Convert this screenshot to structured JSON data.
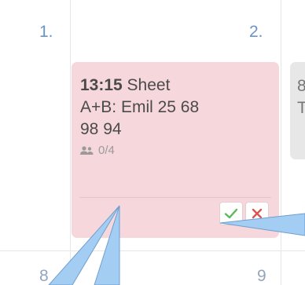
{
  "calendar": {
    "day_numbers": {
      "d1": "1.",
      "d2": "2.",
      "d8": "8",
      "d9": "9"
    },
    "event": {
      "time": "13:15",
      "title_line1": " Sheet",
      "title_line2": "A+B: Emil 25 68",
      "title_line3": "98 94",
      "attendees": "0/4",
      "approve_icon": "check-icon",
      "decline_icon": "x-icon"
    },
    "partial_event": {
      "time_fragment": "8",
      "sub_fragment": "T"
    }
  },
  "colors": {
    "event_background": "#f6d7db",
    "approve_green": "#5cb85c",
    "decline_red": "#d9534f",
    "callout_blue": "#a3cdf2"
  }
}
